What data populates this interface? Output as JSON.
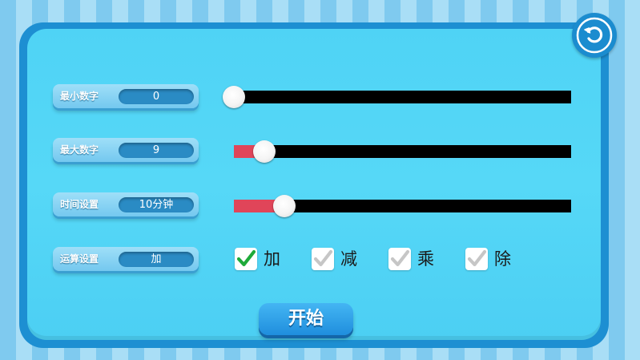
{
  "settings": {
    "min_number": {
      "label": "最小数字",
      "value": "0",
      "slider_percent": 0
    },
    "max_number": {
      "label": "最大数字",
      "value": "9",
      "slider_percent": 9
    },
    "time": {
      "label": "时间设置",
      "value": "10分钟",
      "slider_percent": 15
    },
    "operation": {
      "label": "运算设置",
      "value": "加"
    }
  },
  "operations": [
    {
      "label": "加",
      "checked": true
    },
    {
      "label": "减",
      "checked": false
    },
    {
      "label": "乘",
      "checked": false
    },
    {
      "label": "除",
      "checked": false
    }
  ],
  "start_button": {
    "label": "开始"
  },
  "icons": {
    "back": "refresh-back-icon",
    "check": "checkmark-icon"
  },
  "colors": {
    "panel_border": "#1d8fd2",
    "panel_fill": "#56d8f7",
    "slider_track": "#000000",
    "slider_fill": "#e04559",
    "check_active": "#1eaa3a",
    "check_inactive": "#c6c6c6",
    "start_button": "#2b9fe8"
  }
}
